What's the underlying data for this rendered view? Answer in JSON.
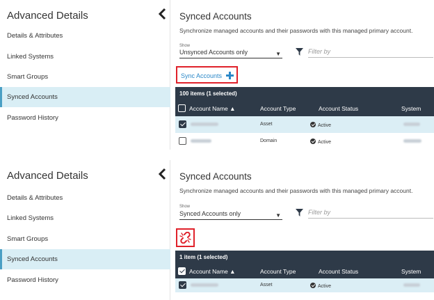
{
  "panel1": {
    "sidebar": {
      "title": "Advanced Details",
      "items": [
        {
          "label": "Details & Attributes"
        },
        {
          "label": "Linked Systems"
        },
        {
          "label": "Smart Groups"
        },
        {
          "label": "Synced Accounts"
        },
        {
          "label": "Password History"
        }
      ],
      "active_index": 3
    },
    "main": {
      "title": "Synced Accounts",
      "description": "Synchronize managed accounts and their passwords with this managed primary account.",
      "show_label": "Show",
      "show_value": "Unsynced Accounts only",
      "filter_placeholder": "Filter by",
      "action_label": "Sync Accounts",
      "action_icon": "plus-icon",
      "table": {
        "count_text": "100 items (1 selected)",
        "columns": [
          "Account Name ▲",
          "Account Type",
          "Account Status",
          "System"
        ],
        "rows": [
          {
            "selected": true,
            "type": "Asset",
            "status": "Active"
          },
          {
            "selected": false,
            "type": "Domain",
            "status": "Active"
          }
        ]
      }
    }
  },
  "panel2": {
    "sidebar": {
      "title": "Advanced Details",
      "items": [
        {
          "label": "Details & Attributes"
        },
        {
          "label": "Linked Systems"
        },
        {
          "label": "Smart Groups"
        },
        {
          "label": "Synced Accounts"
        },
        {
          "label": "Password History"
        }
      ],
      "active_index": 3
    },
    "main": {
      "title": "Synced Accounts",
      "description": "Synchronize managed accounts and their passwords with this managed primary account.",
      "show_label": "Show",
      "show_value": "Synced Accounts only",
      "filter_placeholder": "Filter by",
      "action_icon": "unlink-icon",
      "table": {
        "count_text": "1 item (1 selected)",
        "columns": [
          "Account Name ▲",
          "Account Type",
          "Account Status",
          "System"
        ],
        "rows": [
          {
            "selected": true,
            "type": "Asset",
            "status": "Active"
          }
        ]
      }
    }
  },
  "colors": {
    "accent": "#2b88c8",
    "plus_icon": "#2b88c8",
    "unlink_icon": "#e0212a",
    "highlight_border": "#e0212a",
    "table_header": "#2e3a48",
    "active_nav": "#d9eef5"
  }
}
